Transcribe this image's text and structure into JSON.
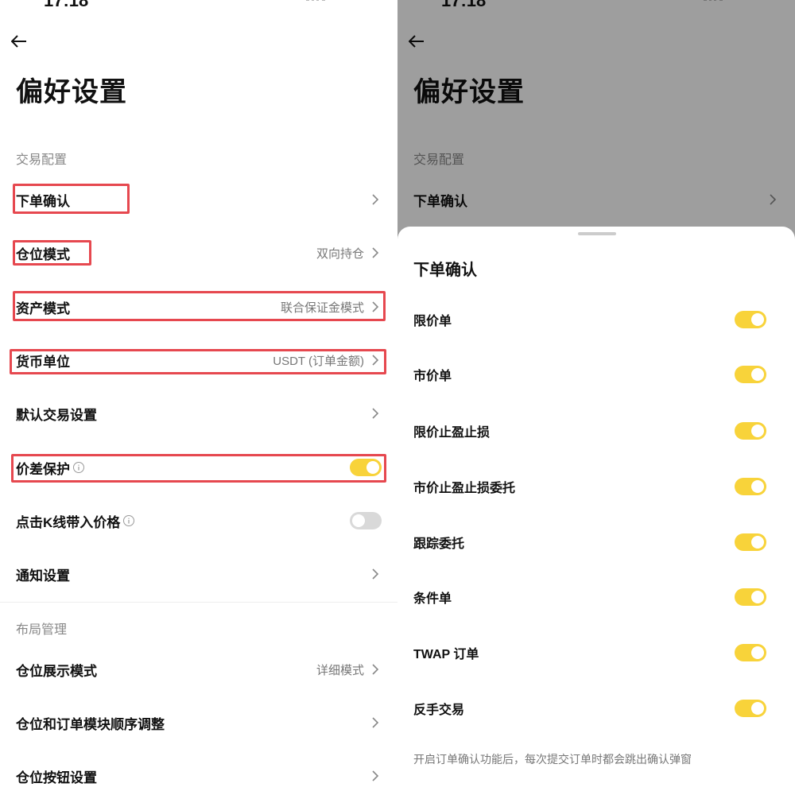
{
  "left": {
    "status_time": "17:18",
    "title": "偏好设置",
    "section1": "交易配置",
    "section2": "布局管理",
    "rows": [
      {
        "label": "下单确认",
        "value": ""
      },
      {
        "label": "仓位模式",
        "value": "双向持仓"
      },
      {
        "label": "资产模式",
        "value": "联合保证金模式"
      },
      {
        "label": "货币单位",
        "value": "USDT (订单金额)"
      },
      {
        "label": "默认交易设置",
        "value": ""
      },
      {
        "label": "价差保护",
        "toggle": "on"
      },
      {
        "label": "点击K线带入价格",
        "toggle": "off"
      },
      {
        "label": "通知设置",
        "value": ""
      },
      {
        "label": "仓位展示模式",
        "value": "详细模式"
      },
      {
        "label": "仓位和订单模块顺序调整",
        "value": ""
      },
      {
        "label": "仓位按钮设置",
        "value": ""
      }
    ]
  },
  "right": {
    "status_time": "17:18",
    "title": "偏好设置",
    "section1": "交易配置",
    "row1": "下单确认",
    "sheet": {
      "title": "下单确认",
      "items": [
        {
          "label": "限价单",
          "toggle": "on"
        },
        {
          "label": "市价单",
          "toggle": "on"
        },
        {
          "label": "限价止盈止损",
          "toggle": "on"
        },
        {
          "label": "市价止盈止损委托",
          "toggle": "on"
        },
        {
          "label": "跟踪委托",
          "toggle": "on"
        },
        {
          "label": "条件单",
          "toggle": "on"
        },
        {
          "label": "TWAP 订单",
          "toggle": "on"
        },
        {
          "label": "反手交易",
          "toggle": "on"
        }
      ],
      "note": "开启订单确认功能后，每次提交订单时都会跳出确认弹窗"
    }
  },
  "colors": {
    "accent_yellow": "#f8d33a",
    "highlight_red": "#e6484f",
    "toggle_off": "#d9d9d9"
  },
  "icons": {
    "back": "arrow-left-icon",
    "chevron": "chevron-right-icon",
    "info": "info-icon"
  }
}
